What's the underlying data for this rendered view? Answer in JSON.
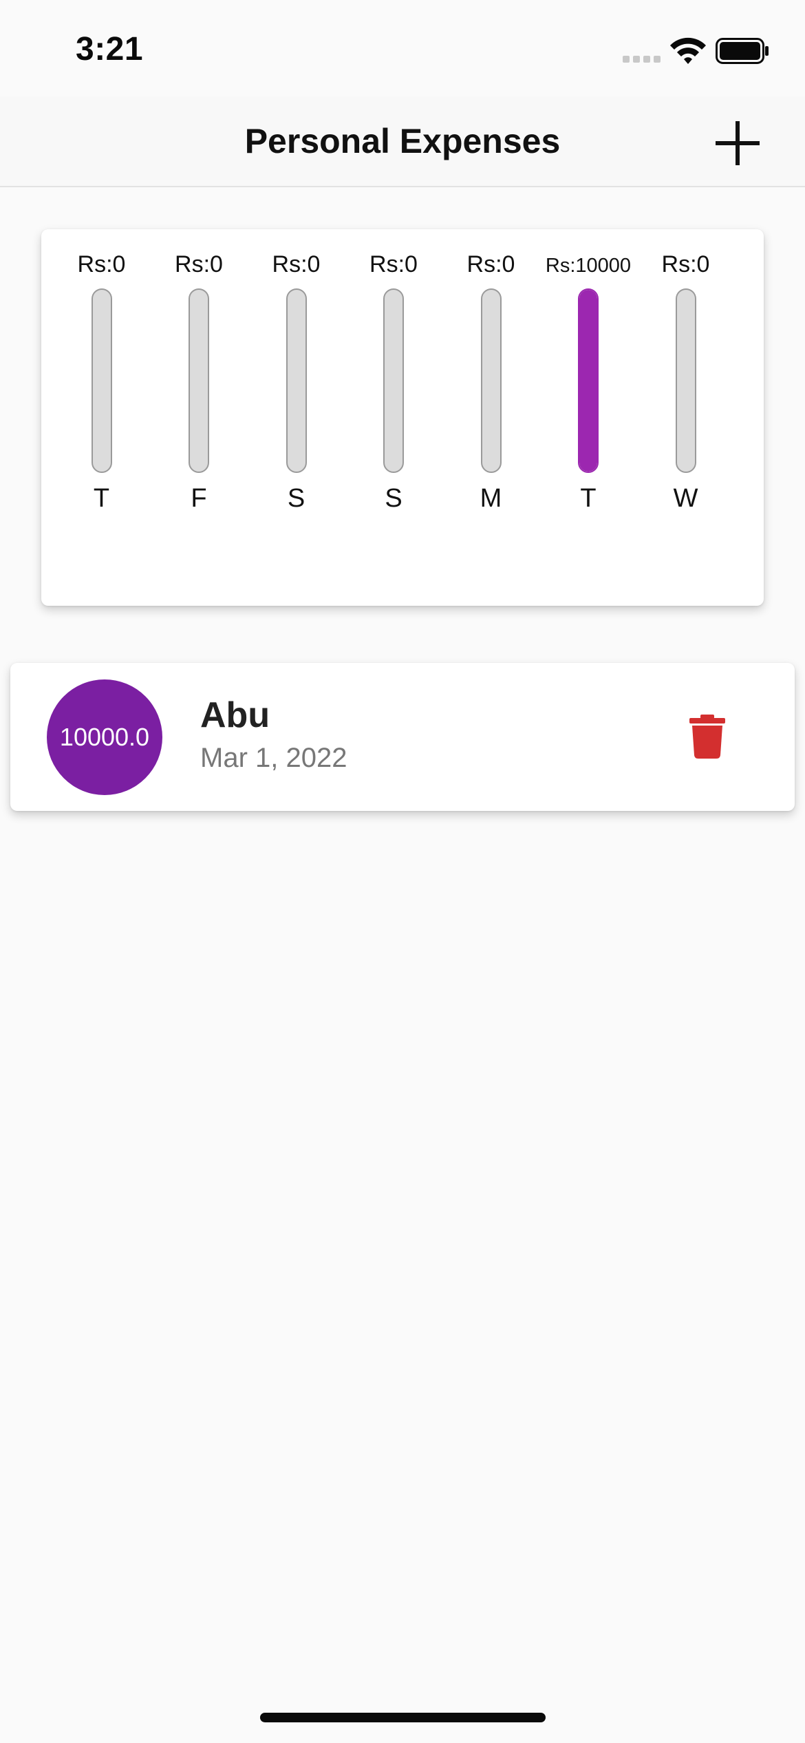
{
  "status_bar": {
    "time": "3:21"
  },
  "app_bar": {
    "title": "Personal Expenses"
  },
  "accent_color": "#9c27b0",
  "chart_data": {
    "type": "bar",
    "categories": [
      "T",
      "F",
      "S",
      "S",
      "M",
      "T",
      "W"
    ],
    "amount_labels": [
      "Rs:0",
      "Rs:0",
      "Rs:0",
      "Rs:0",
      "Rs:0",
      "Rs:10000",
      "Rs:0"
    ],
    "values": [
      0,
      0,
      0,
      0,
      0,
      10000,
      0
    ],
    "spending_fraction": [
      0,
      0,
      0,
      0,
      0,
      1,
      0
    ]
  },
  "transactions": [
    {
      "amount": "10000.0",
      "title": "Abu",
      "date": "Mar 1, 2022"
    }
  ],
  "icons": {
    "add": "plus-icon",
    "delete": "trash-icon"
  }
}
